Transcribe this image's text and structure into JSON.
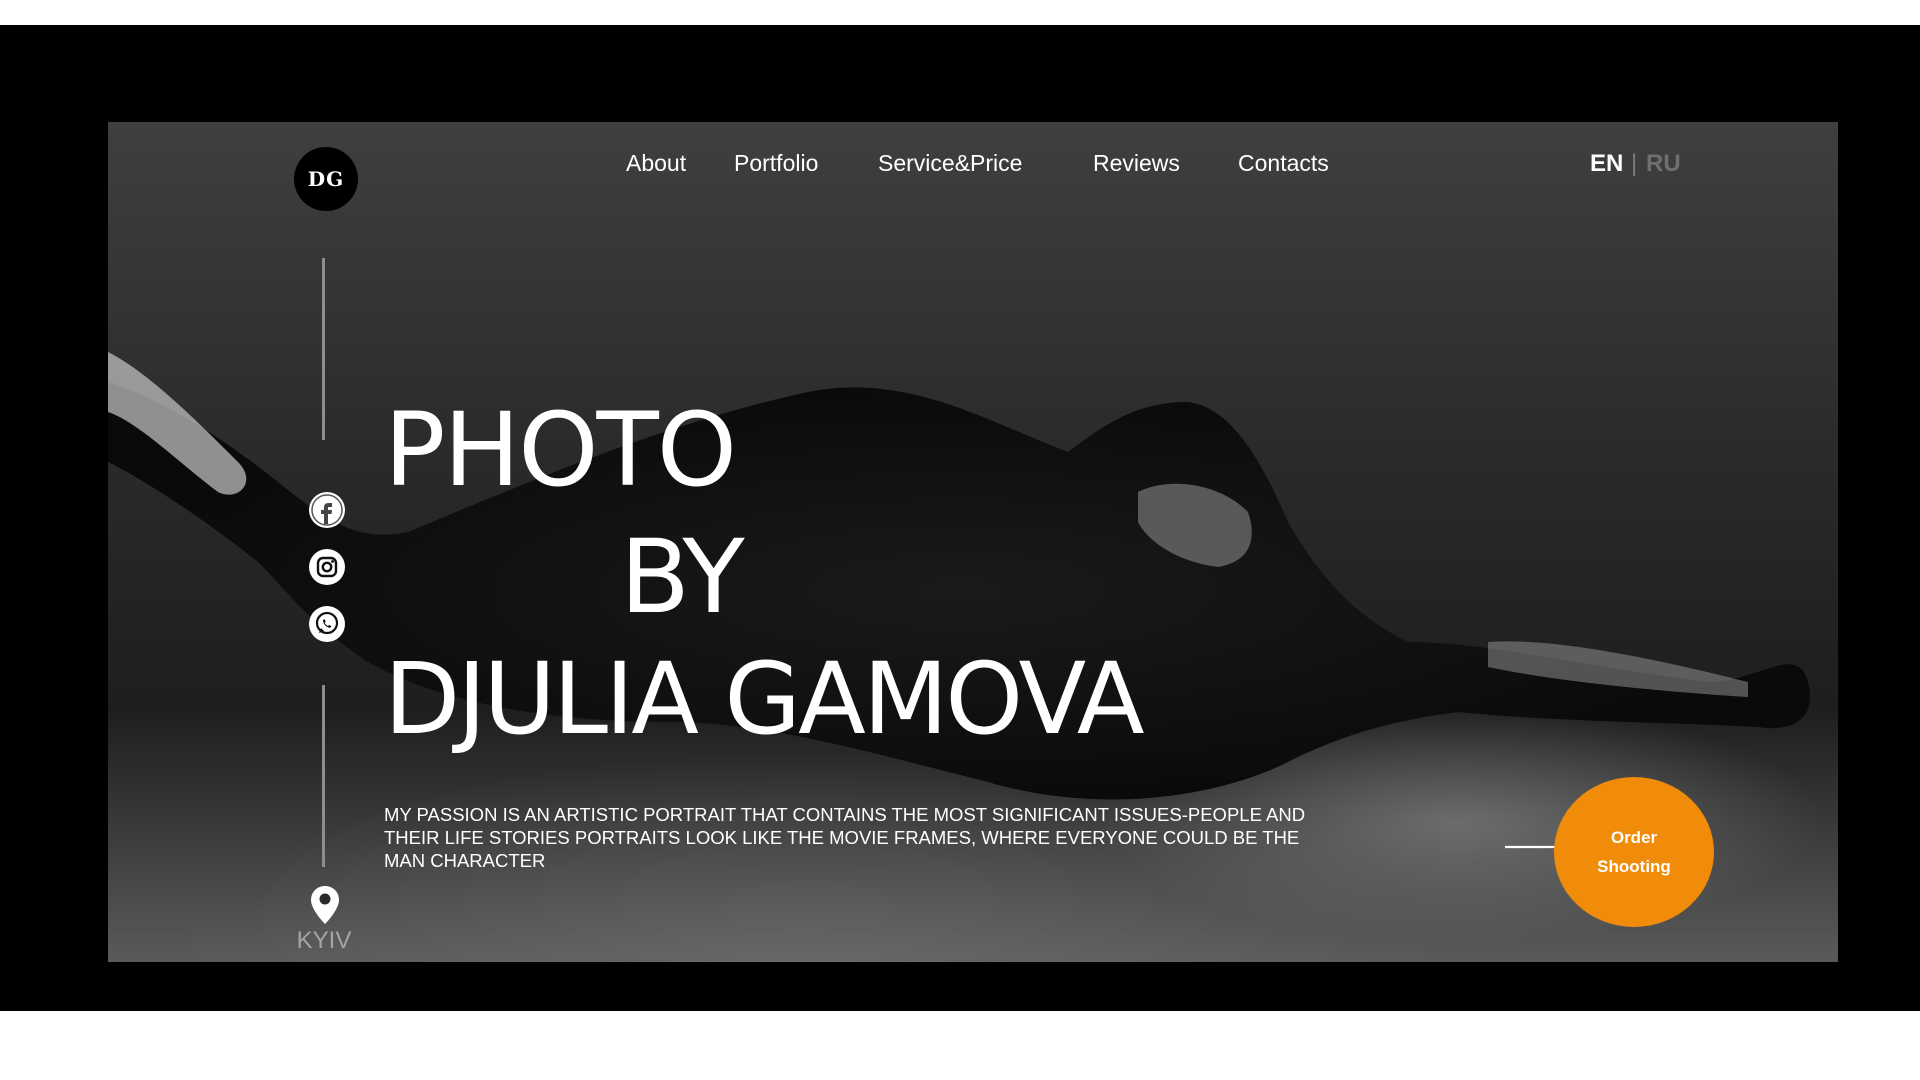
{
  "logo": {
    "text": "DG"
  },
  "nav": {
    "items": [
      {
        "label": "About"
      },
      {
        "label": "Portfolio"
      },
      {
        "label": "Service&Price"
      },
      {
        "label": "Reviews"
      },
      {
        "label": "Contacts"
      }
    ]
  },
  "lang": {
    "active": "EN",
    "separator": "|",
    "inactive": "RU"
  },
  "social": [
    {
      "icon": "facebook-icon"
    },
    {
      "icon": "instagram-icon"
    },
    {
      "icon": "whatsapp-icon"
    }
  ],
  "location": {
    "icon": "location-pin-icon",
    "city": "KYIV"
  },
  "hero": {
    "line1": "PHOTO",
    "line2": "BY",
    "line3": "DJULIA GAMOVA",
    "tagline": "MY PASSION IS AN ARTISTIC PORTRAIT THAT CONTAINS THE MOST SIGNIFICANT ISSUES-PEOPLE AND THEIR LIFE STORIES PORTRAITS LOOK LIKE THE MOVIE FRAMES, WHERE EVERYONE COULD BE THE MAN CHARACTER"
  },
  "cta": {
    "line1": "Order",
    "line2": "Shooting",
    "color": "#f08c0a",
    "icon": "arrow-right-icon"
  },
  "colors": {
    "frame": "#000000",
    "accent": "#f08c0a",
    "text": "#ffffff",
    "muted": "#8e8e8e"
  }
}
